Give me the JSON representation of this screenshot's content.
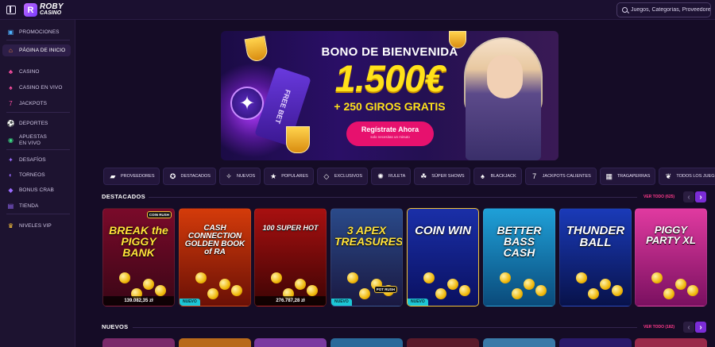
{
  "header": {
    "logo": {
      "mark": "R",
      "line1": "ROBY",
      "line2": "CASINO"
    },
    "search": {
      "placeholder": "Juegos, Categorías, Proveedores"
    }
  },
  "sidebar": {
    "items": [
      {
        "label": "PROMOCIONES",
        "icon": "gift-icon",
        "color": "#4fb3ff"
      },
      {
        "label": "PÁGINA DE INICIO",
        "icon": "home-icon",
        "color": "#ff8a3d",
        "active": true
      },
      {
        "label": "CASINO",
        "icon": "casino-icon",
        "color": "#ff4fa3"
      },
      {
        "label": "CASINO EN VIVO",
        "icon": "live-casino-icon",
        "color": "#ff4fa3"
      },
      {
        "label": "JACKPOTS",
        "icon": "jackpot-icon",
        "color": "#ff4fa3"
      },
      {
        "label": "DEPORTES",
        "icon": "sports-icon",
        "color": "#3ddc84"
      },
      {
        "label": "APUESTAS EN VIVO",
        "icon": "live-bets-icon",
        "color": "#3ddc84"
      },
      {
        "label": "DESAFÍOS",
        "icon": "challenges-icon",
        "color": "#9a6bff"
      },
      {
        "label": "TORNEOS",
        "icon": "tournaments-icon",
        "color": "#9a6bff"
      },
      {
        "label": "BONUS CRAB",
        "icon": "crab-icon",
        "color": "#9a6bff"
      },
      {
        "label": "TIENDA",
        "icon": "shop-icon",
        "color": "#9a6bff"
      },
      {
        "label": "NIVELES VIP",
        "icon": "crown-icon",
        "color": "#ffc93c"
      }
    ]
  },
  "banner": {
    "title": "BONO DE BIENVENIDA",
    "amount": "1.500€",
    "subtitle": "+ 250 GIROS GRATIS",
    "cta": "Regístrate Ahora",
    "cta_note": "solo necesitas un minuto",
    "ticket_text": "FREE BET"
  },
  "categories": [
    {
      "label": "PROVEEDORES",
      "icon": "folder-icon"
    },
    {
      "label": "DESTACADOS",
      "icon": "medal-icon"
    },
    {
      "label": "NUEVOS",
      "icon": "sparkle-icon"
    },
    {
      "label": "POPULARES",
      "icon": "star-icon"
    },
    {
      "label": "EXCLUSIVOS",
      "icon": "diamond-icon"
    },
    {
      "label": "RULETA",
      "icon": "roulette-icon"
    },
    {
      "label": "SÚPER SHOWS",
      "icon": "super-shows-icon"
    },
    {
      "label": "BLACKJACK",
      "icon": "spade-icon"
    },
    {
      "label": "JACKPOTS CALIENTES",
      "icon": "seven-icon"
    },
    {
      "label": "TRAGAPERRAS",
      "icon": "slot-machine-icon"
    },
    {
      "label": "TODOS LOS JUEGOS",
      "icon": "cherries-icon"
    }
  ],
  "sections": {
    "featured": {
      "title": "DESTACADOS",
      "see_all": "VER TODO (625)"
    },
    "new": {
      "title": "NUEVOS",
      "see_all": "VER TODO (182)"
    },
    "prev_arrow": "‹",
    "next_arrow": "›"
  },
  "games": [
    {
      "name": "Break the Piggy Bank",
      "title": "BREAK the PIGGY BANK",
      "amount": "139.082,35 zł",
      "badge": "",
      "corner": "COIN RUSH",
      "bg_top": "#7a0a2a",
      "bg_bottom": "#3a0616"
    },
    {
      "name": "Cash Connection Golden Book of Ra",
      "title": "CASH CONNECTION GOLDEN BOOK of RA",
      "amount": "",
      "badge": "NUEVO",
      "corner": "",
      "bg_top": "#d43b0a",
      "bg_bottom": "#6a1006"
    },
    {
      "name": "100 Super Hot",
      "title": "100 SUPER HOT",
      "amount": "276.787,28 zł",
      "badge": "",
      "corner": "",
      "bg_top": "#a81010",
      "bg_bottom": "#3d0404"
    },
    {
      "name": "3 Apex Treasures",
      "title": "3 APEX TREASURES",
      "amount": "",
      "badge": "NUEVO",
      "corner": "POT RUSH",
      "bg_top": "#2a4a8a",
      "bg_bottom": "#1a1840"
    },
    {
      "name": "Coin Win",
      "title": "COIN WIN",
      "amount": "",
      "badge": "NUEVO",
      "corner": "",
      "bg_top": "#1a2fa8",
      "bg_bottom": "#0a1060"
    },
    {
      "name": "Better Bass Cash",
      "title": "BETTER BASS CASH",
      "amount": "",
      "badge": "",
      "corner": "",
      "bg_top": "#1fa0d8",
      "bg_bottom": "#0a4a7a"
    },
    {
      "name": "Thunder Ball",
      "title": "THUNDER BALL",
      "amount": "",
      "badge": "",
      "corner": "",
      "bg_top": "#1a3ab8",
      "bg_bottom": "#08124a"
    },
    {
      "name": "Piggy Party XL",
      "title": "PIGGY PARTY XL",
      "amount": "",
      "badge": "",
      "corner": "",
      "bg_top": "#e03aa0",
      "bg_bottom": "#7a1060"
    }
  ],
  "row2_colors": [
    "#7a2a6a",
    "#b86a1a",
    "#7a3aa0",
    "#2a6a9a",
    "#5a1a2a",
    "#3a7aa8",
    "#2a1a6a",
    "#9a2a4a"
  ]
}
